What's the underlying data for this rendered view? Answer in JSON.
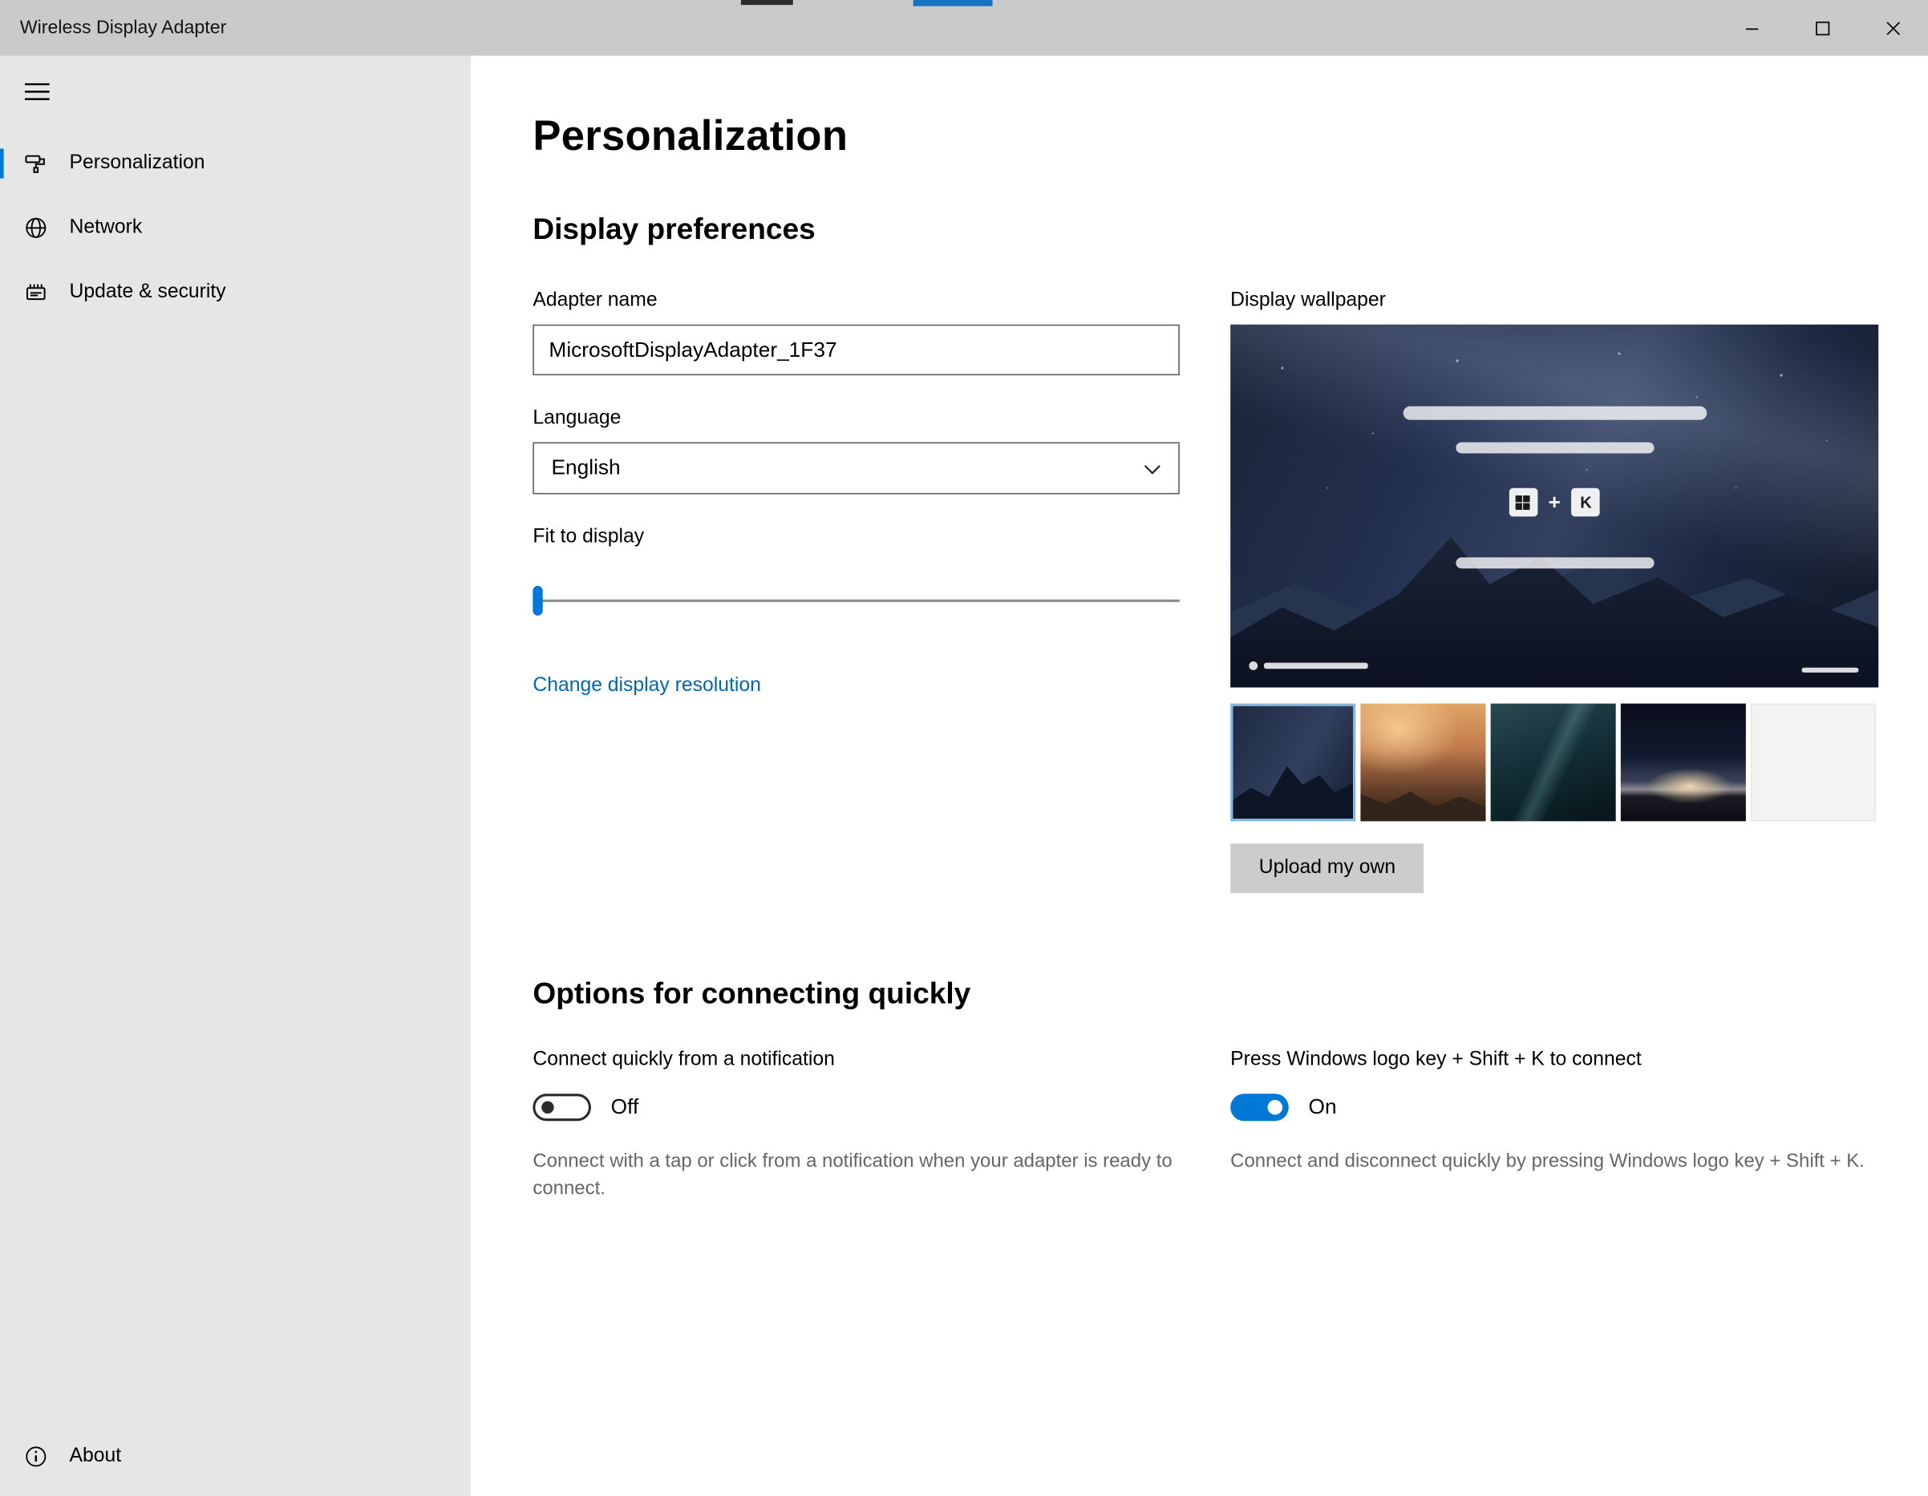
{
  "titlebar": {
    "title": "Wireless Display Adapter"
  },
  "sidebar": {
    "items": [
      {
        "label": "Personalization",
        "selected": true
      },
      {
        "label": "Network",
        "selected": false
      },
      {
        "label": "Update & security",
        "selected": false
      }
    ],
    "about_label": "About"
  },
  "main": {
    "page_title": "Personalization",
    "display_preferences": {
      "heading": "Display preferences",
      "adapter_name_label": "Adapter name",
      "adapter_name_value": "MicrosoftDisplayAdapter_1F37",
      "language_label": "Language",
      "language_selected": "English",
      "fit_to_display_label": "Fit to display",
      "slider_value_percent": 0,
      "change_resolution_link": "Change display resolution"
    },
    "wallpaper": {
      "label": "Display wallpaper",
      "upload_button": "Upload my own",
      "shortcut_plus": "+",
      "shortcut_key": "K",
      "thumbnails": [
        "mountain-night",
        "sunset-valley",
        "dark-ocean",
        "night-horizon",
        "blank-light"
      ],
      "selected_thumbnail_index": 0
    },
    "quick_connect": {
      "heading": "Options for connecting quickly",
      "notification_toggle": {
        "label": "Connect quickly from a notification",
        "state": "Off",
        "description": "Connect with a tap or click from a notification when your adapter is ready to connect."
      },
      "hotkey_toggle": {
        "label": "Press Windows logo key + Shift + K to connect",
        "state": "On",
        "description": "Connect and disconnect quickly by pressing Windows logo key + Shift + K."
      }
    }
  },
  "colors": {
    "accent": "#0078d7",
    "link": "#0067b4",
    "sidebar_bg": "#e6e6e6",
    "titlebar_bg": "#cacaca"
  }
}
